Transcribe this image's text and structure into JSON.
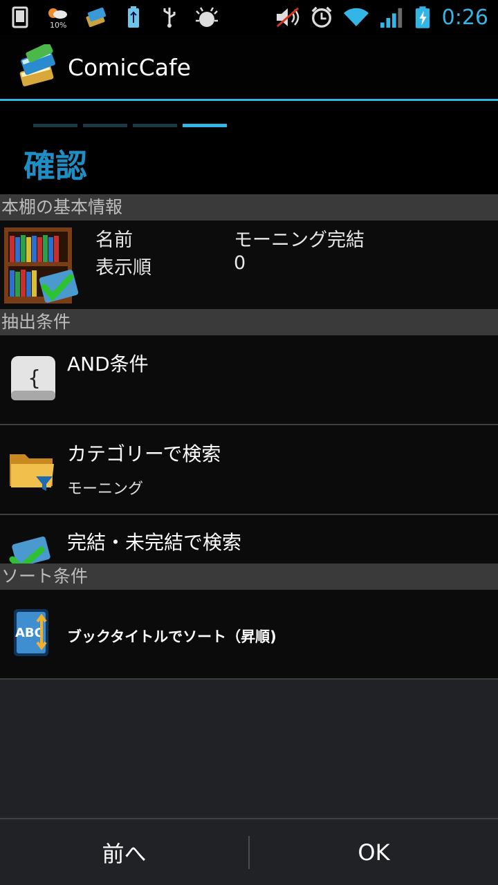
{
  "status_bar": {
    "time": "0:26",
    "weather_percent": "10%",
    "icons_left": [
      "phone-icon",
      "weather-icon",
      "comiccafe-notify-icon",
      "usb-battery-icon",
      "usb-icon",
      "debug-icon"
    ],
    "icons_right": [
      "mute-icon",
      "alarm-icon",
      "wifi-icon",
      "signal-icon",
      "battery-charging-icon"
    ]
  },
  "action_bar": {
    "title": "ComicCafe",
    "accent": "#33b5e5"
  },
  "wizard": {
    "steps": 4,
    "active_step": 4,
    "title": "確認"
  },
  "sections": {
    "shelf_header": "本棚の基本情報",
    "filter_header": "抽出条件",
    "sort_header": "ソート条件"
  },
  "shelf": {
    "name_label": "名前",
    "name_value": "モーニング完結",
    "order_label": "表示順",
    "order_value": "0"
  },
  "filters": [
    {
      "title": "AND条件",
      "subtitle": ""
    },
    {
      "title": "カテゴリーで検索",
      "subtitle": "モーニング"
    },
    {
      "title": "完結・未完結で検索",
      "subtitle": ""
    }
  ],
  "sort": {
    "label": "ブックタイトルでソート（昇順)"
  },
  "buttons": {
    "back": "前へ",
    "ok": "OK"
  }
}
